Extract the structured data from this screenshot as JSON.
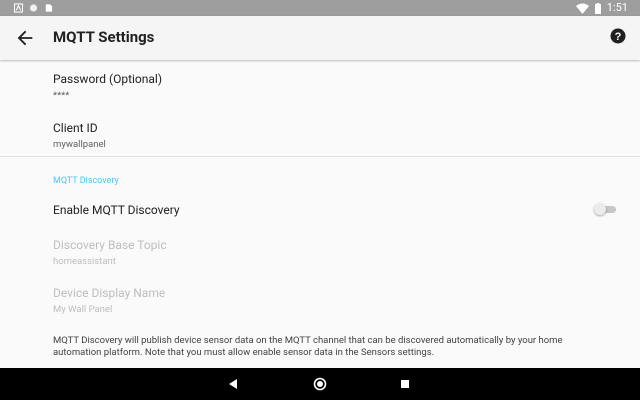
{
  "status_bar": {
    "time": "1:51"
  },
  "app_bar": {
    "title": "MQTT Settings"
  },
  "prefs": {
    "password": {
      "title": "Password (Optional)",
      "summary": "****"
    },
    "client_id": {
      "title": "Client ID",
      "summary": "mywallpanel"
    },
    "category": "MQTT Discovery",
    "enable_discovery": {
      "title": "Enable MQTT Discovery",
      "checked": false
    },
    "base_topic": {
      "title": "Discovery Base Topic",
      "summary": "homeassistant"
    },
    "display_name": {
      "title": "Device Display Name",
      "summary": "My Wall Panel"
    },
    "description": "MQTT Discovery will publish device sensor data on the MQTT channel that can be discovered automatically by your home automation platform. Note that you must allow enable sensor data in the Sensors settings."
  },
  "colors": {
    "accent": "#4fc3f7",
    "status_bar": "#9e9e9e",
    "app_bar": "#f5f5f5"
  }
}
